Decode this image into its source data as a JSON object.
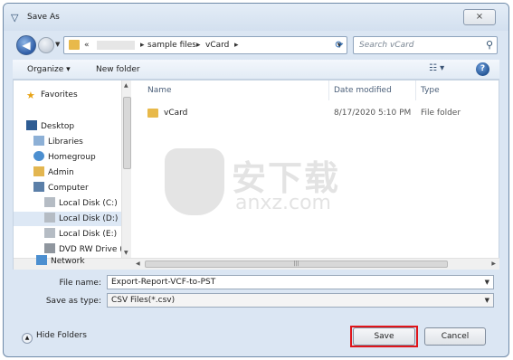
{
  "window": {
    "title": "Save As",
    "close_label": "⨯"
  },
  "address": {
    "chevron_back": "«",
    "crumbs": [
      "sample files",
      "vCard"
    ],
    "separator": "▸"
  },
  "search": {
    "placeholder": "Search vCard"
  },
  "toolbar": {
    "organize_label": "Organize ▾",
    "new_folder_label": "New folder",
    "views_label": "☷ ▾",
    "help_label": "?"
  },
  "nav": {
    "items": [
      {
        "label": "Favorites",
        "icon": "star-icon"
      },
      {
        "label": "Desktop",
        "icon": "desktop-icon"
      },
      {
        "label": "Libraries",
        "icon": "libraries-icon"
      },
      {
        "label": "Homegroup",
        "icon": "homegroup-icon"
      },
      {
        "label": "Admin",
        "icon": "user-folder-icon"
      },
      {
        "label": "Computer",
        "icon": "computer-icon"
      },
      {
        "label": "Local Disk (C:)",
        "icon": "drive-icon"
      },
      {
        "label": "Local Disk (D:)",
        "icon": "drive-icon",
        "selected": true
      },
      {
        "label": "Local Disk (E:)",
        "icon": "drive-icon"
      },
      {
        "label": "DVD RW Drive (",
        "icon": "dvd-icon"
      },
      {
        "label": "Network",
        "icon": "network-icon"
      }
    ]
  },
  "columns": {
    "name": "Name",
    "date": "Date modified",
    "type": "Type"
  },
  "files": [
    {
      "name": "vCard",
      "date": "8/17/2020 5:10 PM",
      "type": "File folder"
    }
  ],
  "watermark": {
    "cn": "安下载",
    "en": "anxz.com"
  },
  "form": {
    "filename_label": "File name:",
    "filename_value": "Export-Report-VCF-to-PST",
    "savetype_label": "Save as type:",
    "savetype_value": "CSV Files(*.csv)"
  },
  "footer": {
    "hide_folders_label": "Hide Folders",
    "save_label": "Save",
    "cancel_label": "Cancel"
  },
  "colors": {
    "highlight": "#e0151a",
    "accent": "#2f5ea8"
  }
}
